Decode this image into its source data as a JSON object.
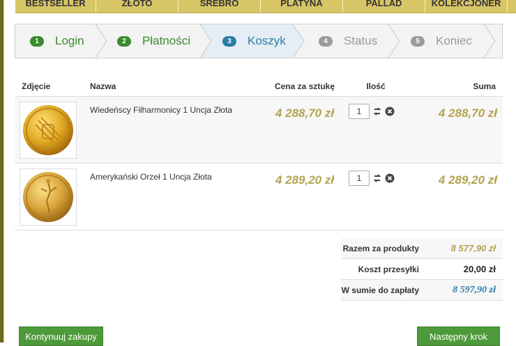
{
  "topnav": [
    "BESTSELLER",
    "ZŁOTO",
    "SREBRO",
    "PLATYNA",
    "PALLAD",
    "KOLEKCJONER"
  ],
  "steps": [
    {
      "num": "1",
      "label": "Login"
    },
    {
      "num": "2",
      "label": "Płatności"
    },
    {
      "num": "3",
      "label": "Koszyk"
    },
    {
      "num": "4",
      "label": "Status"
    },
    {
      "num": "5",
      "label": "Koniec"
    }
  ],
  "table": {
    "headers": {
      "photo": "Zdjęcie",
      "name": "Nazwa",
      "unit_price": "Cena za sztukę",
      "qty": "Ilość",
      "sum": "Suma"
    },
    "rows": [
      {
        "name": "Wiedeńscy Filharmonicy 1 Uncja Złota",
        "unit_price": "4 288,70 zł",
        "qty": "1",
        "sum": "4 288,70 zł"
      },
      {
        "name": "Amerykański Orzeł 1 Uncja Złota",
        "unit_price": "4 289,20 zł",
        "qty": "1",
        "sum": "4 289,20 zł"
      }
    ]
  },
  "summary": {
    "products_label": "Razem za produkty",
    "products_value": "8 577,90 zł",
    "shipping_label": "Koszt przesyłki",
    "shipping_value": "20,00 zł",
    "total_label": "W sumie do zapłaty",
    "total_value": "8 597,90 zł"
  },
  "buttons": {
    "continue": "Kontynuuj zakupy",
    "next": "Następny krok"
  },
  "colors": {
    "green": "#3b8a2e",
    "blue": "#2a7ca8",
    "gold": "#b5a351",
    "total_blue": "#2a7ca8"
  }
}
